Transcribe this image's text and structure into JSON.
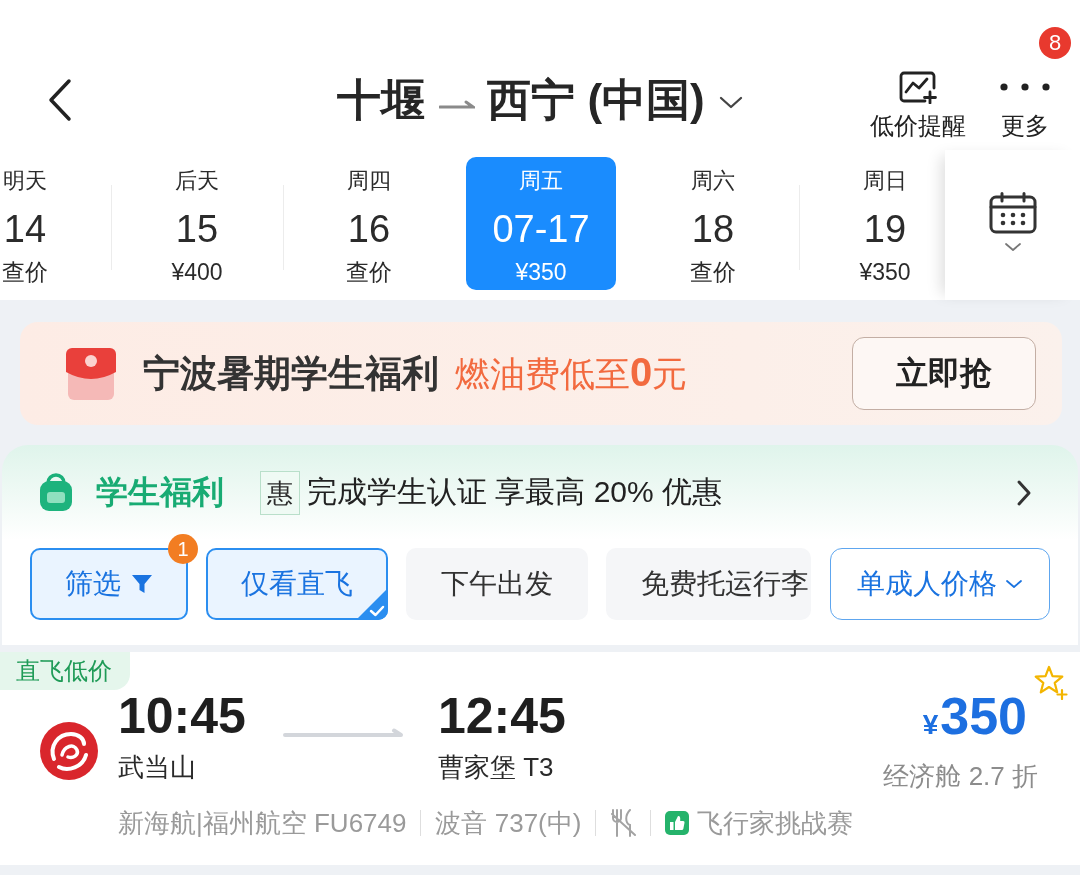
{
  "header": {
    "origin": "十堰",
    "destination": "西宁 (中国)",
    "actions": [
      {
        "kind": "price_alert",
        "label": "低价提醒"
      },
      {
        "kind": "more",
        "label": "更多",
        "badge": "8"
      }
    ]
  },
  "dates": [
    {
      "weekday": "明天",
      "day": "14",
      "price": "查价",
      "selected": false
    },
    {
      "weekday": "后天",
      "day": "15",
      "price": "¥400",
      "selected": false
    },
    {
      "weekday": "周四",
      "day": "16",
      "price": "查价",
      "selected": false
    },
    {
      "weekday": "周五",
      "day": "07-17",
      "price": "¥350",
      "selected": true
    },
    {
      "weekday": "周六",
      "day": "18",
      "price": "查价",
      "selected": false
    },
    {
      "weekday": "周日",
      "day": "19",
      "price": "¥350",
      "selected": false
    }
  ],
  "promo_banner": {
    "title": "宁波暑期学生福利",
    "highlight": "燃油费低至**0**元",
    "button": "立即抢"
  },
  "student_benefit": {
    "title": "学生福利",
    "tag": "惠",
    "text": "完成学生认证 享最高 20% 优惠"
  },
  "filters": [
    {
      "kind": "filter",
      "label": "筛选",
      "badge": "1",
      "selected": true
    },
    {
      "kind": "toggle",
      "label": "仅看直飞",
      "selected": true
    },
    {
      "kind": "toggle",
      "label": "下午出发",
      "selected": false
    },
    {
      "kind": "toggle",
      "label": "免费托运行李",
      "selected": false
    }
  ],
  "price_mode": {
    "label": "单成人价格"
  },
  "flight": {
    "tag": "直飞低价",
    "depart_time": "10:45",
    "depart_airport": "武当山",
    "arrive_time": "12:45",
    "arrive_airport": "曹家堡 T3",
    "currency": "¥",
    "price": "350",
    "cabin": "经济舱 2.7 折",
    "details": [
      {
        "kind": "text",
        "text": "新海航|福州航空 FU6749"
      },
      {
        "kind": "text",
        "text": "波音 737(中)"
      },
      {
        "kind": "meal"
      },
      {
        "kind": "badge",
        "text": "飞行家挑战赛"
      }
    ]
  }
}
